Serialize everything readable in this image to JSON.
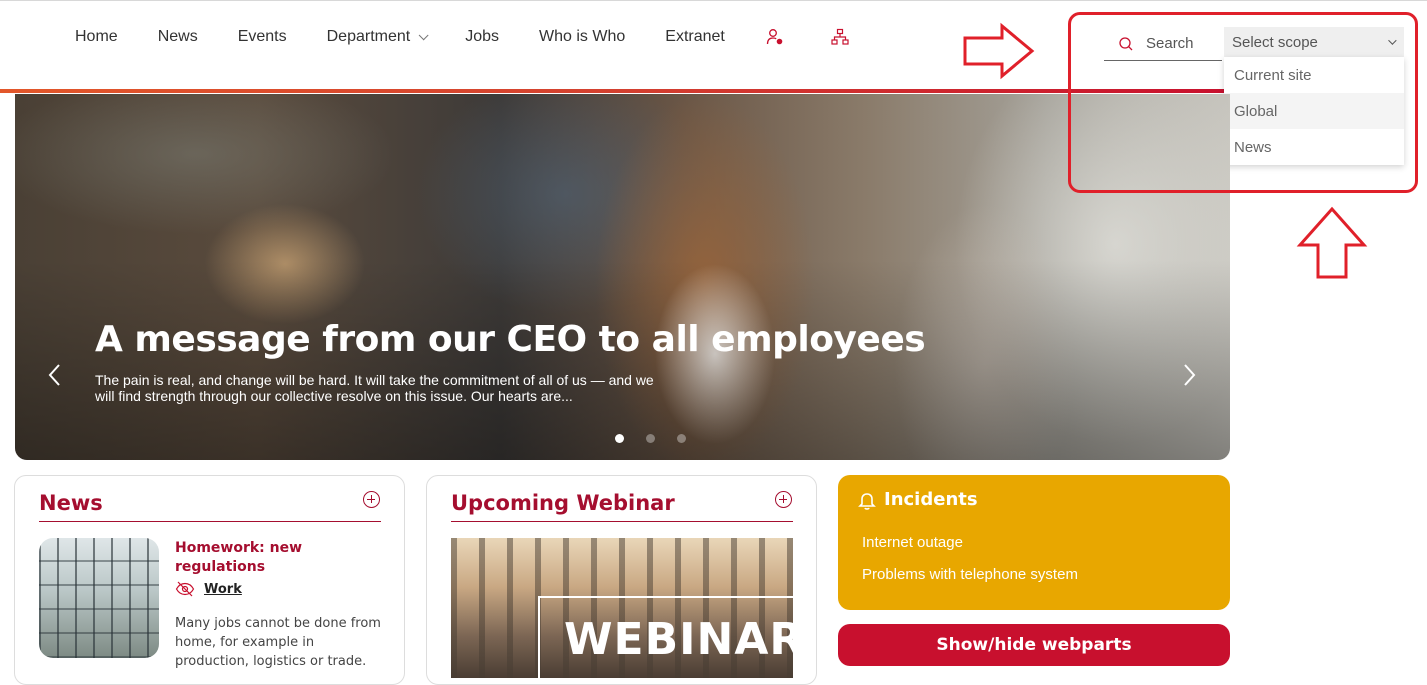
{
  "nav": {
    "items": [
      {
        "label": "Home"
      },
      {
        "label": "News"
      },
      {
        "label": "Events"
      },
      {
        "label": "Department",
        "has_dropdown": true
      },
      {
        "label": "Jobs"
      },
      {
        "label": "Who is Who"
      },
      {
        "label": "Extranet"
      }
    ],
    "icons": [
      "person-settings-icon",
      "org-chart-icon"
    ]
  },
  "search": {
    "placeholder": "Search",
    "scope_label": "Select scope",
    "scope_options": [
      "Current site",
      "Global",
      "News"
    ],
    "highlighted_option": "Global"
  },
  "hero": {
    "title": "A message from our CEO to all employees",
    "subtitle": "The pain is real, and change will be hard. It will take the commitment of all of us — and we will find strength through our collective resolve on this issue. Our hearts are...",
    "slide_count": 3,
    "active_slide": 1
  },
  "news_card": {
    "title": "News",
    "item": {
      "headline": "Homework: new regulations",
      "tag": "Work",
      "body": "Many jobs cannot be done from home, for example in production, logistics or trade."
    }
  },
  "webinar_card": {
    "title": "Upcoming Webinar",
    "image_text": "WEBINAR"
  },
  "incidents": {
    "title": "Incidents",
    "items": [
      "Internet outage",
      "Problems with telephone system"
    ]
  },
  "toggle_button": {
    "label": "Show/hide webparts"
  },
  "colors": {
    "brand": "#a50e2f",
    "button": "#c8102e",
    "incidents_bg": "#e8a700",
    "annotation": "#e0202a"
  }
}
